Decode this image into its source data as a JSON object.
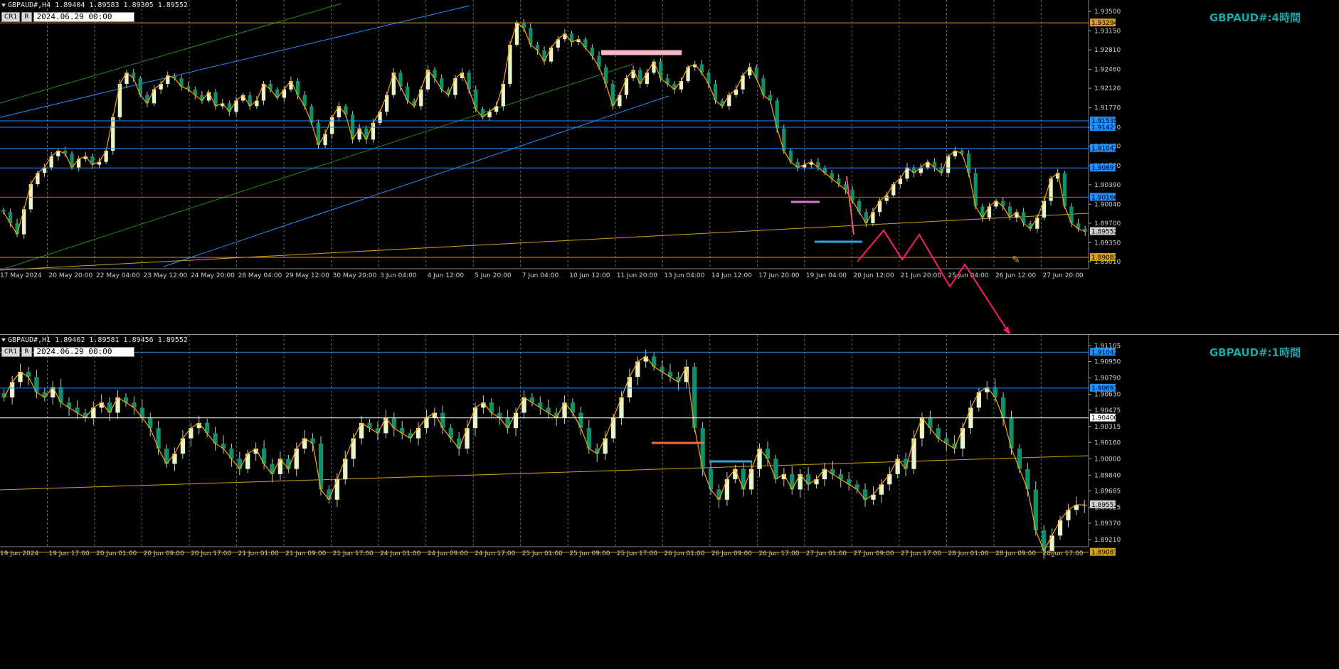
{
  "colors": {
    "background": "#000000",
    "bull": "#e8f5c8",
    "bear": "#0f8f6a",
    "wick": "#c8c8c8",
    "zigzag": "#ffa500",
    "trend_yellow": "#d4a017",
    "trend_green": "#1e8e1e",
    "trend_blue": "#1e90ff",
    "hline_blue": "#1e90ff",
    "hline_yellow": "#d4a017",
    "grid": "#6a6a6a",
    "forecast": "#ff1a6c",
    "title": "#17a6a6"
  },
  "chart_data": [
    {
      "type": "candlestick",
      "symbol": "GBPAUD#",
      "timeframe": "H4",
      "header": "GBPAUD#,H4  1.89404 1.89583 1.89305 1.89552",
      "title": "GBPAUD#:4時間",
      "date_box": "2024.06.29 00:00",
      "buttons": [
        "CR1",
        "R"
      ],
      "ylim": [
        1.8901,
        1.935
      ],
      "y_ticks": [
        1.935,
        1.9315,
        1.9281,
        1.9246,
        1.9212,
        1.9177,
        1.9142,
        1.9108,
        1.9073,
        1.9039,
        1.9004,
        1.897,
        1.8935,
        1.8901
      ],
      "x_labels": [
        "17 May 2024",
        "20 May 20:00",
        "22 May 04:00",
        "23 May 12:00",
        "24 May 20:00",
        "28 May 04:00",
        "29 May 12:00",
        "30 May 20:00",
        "3 Jun 04:00",
        "4 Jun 12:00",
        "5 Jun 20:00",
        "7 Jun 04:00",
        "10 Jun 12:00",
        "11 Jun 20:00",
        "13 Jun 04:00",
        "14 Jun 12:00",
        "17 Jun 20:00",
        "19 Jun 04:00",
        "20 Jun 12:00",
        "21 Jun 20:00",
        "25 Jun 04:00",
        "26 Jun 12:00",
        "27 Jun 20:00"
      ],
      "price_levels": [
        {
          "price": 1.93294,
          "label": "1.93294",
          "style": "yellow"
        },
        {
          "price": 1.91535,
          "label": "1.91535",
          "style": "blue"
        },
        {
          "price": 1.91421,
          "label": "1.91421",
          "style": "blue"
        },
        {
          "price": 1.91042,
          "label": "1.91042",
          "style": "blue"
        },
        {
          "price": 1.90691,
          "label": "1.90691",
          "style": "blue"
        },
        {
          "price": 1.90166,
          "label": "1.90166",
          "style": "blue"
        },
        {
          "price": 1.89552,
          "label": "1.89552",
          "style": "current"
        },
        {
          "price": 1.89087,
          "label": "1.89087",
          "style": "yellow"
        }
      ],
      "close_path": [
        1.899,
        1.897,
        1.895,
        1.8995,
        1.904,
        1.906,
        1.907,
        1.909,
        1.91,
        1.9095,
        1.907,
        1.9085,
        1.909,
        1.9075,
        1.908,
        1.91,
        1.916,
        1.922,
        1.924,
        1.923,
        1.92,
        1.9185,
        1.921,
        1.922,
        1.9235,
        1.923,
        1.9215,
        1.921,
        1.92,
        1.919,
        1.9205,
        1.918,
        1.9185,
        1.917,
        1.919,
        1.92,
        1.918,
        1.919,
        1.922,
        1.921,
        1.9195,
        1.921,
        1.9225,
        1.92,
        1.918,
        1.915,
        1.911,
        1.913,
        1.916,
        1.918,
        1.9165,
        1.912,
        1.914,
        1.912,
        1.915,
        1.917,
        1.92,
        1.924,
        1.9215,
        1.919,
        1.918,
        1.921,
        1.9245,
        1.923,
        1.921,
        1.92,
        1.923,
        1.924,
        1.921,
        1.9175,
        1.916,
        1.917,
        1.918,
        1.922,
        1.929,
        1.933,
        1.932,
        1.929,
        1.928,
        1.926,
        1.9285,
        1.93,
        1.931,
        1.9295,
        1.93,
        1.9285,
        1.927,
        1.925,
        1.922,
        1.918,
        1.92,
        1.923,
        1.9245,
        1.922,
        1.924,
        1.926,
        1.923,
        1.922,
        1.921,
        1.9225,
        1.925,
        1.9255,
        1.924,
        1.922,
        1.919,
        1.918,
        1.92,
        1.921,
        1.9235,
        1.925,
        1.923,
        1.92,
        1.919,
        1.914,
        1.91,
        1.908,
        1.907,
        1.9075,
        1.908,
        1.907,
        1.906,
        1.905,
        1.904,
        1.903,
        1.901,
        1.899,
        1.897,
        1.899,
        1.901,
        1.902,
        1.904,
        1.905,
        1.907,
        1.906,
        1.907,
        1.908,
        1.907,
        1.906,
        1.909,
        1.91,
        1.9095,
        1.906,
        1.9,
        1.898,
        1.9,
        1.901,
        1.9,
        1.898,
        1.899,
        1.897,
        1.896,
        1.898,
        1.901,
        1.905,
        1.906,
        1.9,
        1.897,
        1.896,
        1.8955
      ]
    },
    {
      "type": "candlestick",
      "symbol": "GBPAUD#",
      "timeframe": "H1",
      "header": "GBPAUD#,H1  1.89462 1.89581 1.89456 1.89552",
      "title": "GBPAUD#:1時間",
      "date_box": "2024.06.29 00:00",
      "buttons": [
        "CR1",
        "R"
      ],
      "ylim": [
        1.8921,
        1.911
      ],
      "y_ticks": [
        1.91105,
        1.9095,
        1.9079,
        1.9063,
        1.90475,
        1.90315,
        1.9016,
        1.9,
        1.8984,
        1.89685,
        1.89525,
        1.8937,
        1.8921
      ],
      "x_labels": [
        "19 Jun 2024",
        "19 Jun 17:00",
        "20 Jun 01:00",
        "20 Jun 09:00",
        "20 Jun 17:00",
        "21 Jun 01:00",
        "21 Jun 09:00",
        "21 Jun 17:00",
        "24 Jun 01:00",
        "24 Jun 09:00",
        "24 Jun 17:00",
        "25 Jun 01:00",
        "25 Jun 09:00",
        "25 Jun 17:00",
        "26 Jun 01:00",
        "26 Jun 09:00",
        "26 Jun 17:00",
        "27 Jun 01:00",
        "27 Jun 09:00",
        "27 Jun 17:00",
        "28 Jun 01:00",
        "28 Jun 09:00",
        "28 Jun 17:00"
      ],
      "price_levels": [
        {
          "price": 1.91042,
          "label": "1.91042",
          "style": "blue"
        },
        {
          "price": 1.90691,
          "label": "1.90691",
          "style": "blue"
        },
        {
          "price": 1.904,
          "label": "1.90400",
          "style": "white"
        },
        {
          "price": 1.89552,
          "label": "1.89552",
          "style": "current"
        },
        {
          "price": 1.89087,
          "label": "1.89087",
          "style": "yellow"
        }
      ],
      "close_path": [
        1.906,
        1.9075,
        1.9085,
        1.908,
        1.9065,
        1.906,
        1.907,
        1.9055,
        1.905,
        1.9045,
        1.904,
        1.905,
        1.9055,
        1.9045,
        1.906,
        1.9055,
        1.905,
        1.904,
        1.903,
        1.901,
        1.8995,
        1.9005,
        1.902,
        1.903,
        1.9035,
        1.9025,
        1.9015,
        1.901,
        1.9,
        1.899,
        1.9005,
        1.901,
        1.8995,
        1.8985,
        1.9,
        1.899,
        1.901,
        1.902,
        1.9015,
        1.897,
        1.896,
        1.898,
        1.9,
        1.902,
        1.9035,
        1.903,
        1.9025,
        1.904,
        1.903,
        1.9025,
        1.902,
        1.903,
        1.904,
        1.9045,
        1.903,
        1.902,
        1.901,
        1.903,
        1.905,
        1.9055,
        1.9045,
        1.904,
        1.903,
        1.9045,
        1.906,
        1.9055,
        1.905,
        1.9045,
        1.904,
        1.9055,
        1.9045,
        1.903,
        1.901,
        1.9005,
        1.902,
        1.904,
        1.906,
        1.908,
        1.9095,
        1.91,
        1.909,
        1.9085,
        1.908,
        1.9075,
        1.909,
        1.903,
        1.899,
        1.897,
        1.896,
        1.898,
        1.899,
        1.897,
        1.899,
        1.901,
        1.9,
        1.898,
        1.8985,
        1.897,
        1.8985,
        1.8975,
        1.898,
        1.899,
        1.8985,
        1.898,
        1.8975,
        1.897,
        1.896,
        1.8965,
        1.8975,
        1.8985,
        1.9,
        1.899,
        1.902,
        1.904,
        1.903,
        1.902,
        1.9015,
        1.901,
        1.903,
        1.905,
        1.9065,
        1.907,
        1.906,
        1.904,
        1.901,
        1.899,
        1.897,
        1.893,
        1.891,
        1.8925,
        1.894,
        1.895,
        1.8955,
        1.8955
      ]
    }
  ]
}
